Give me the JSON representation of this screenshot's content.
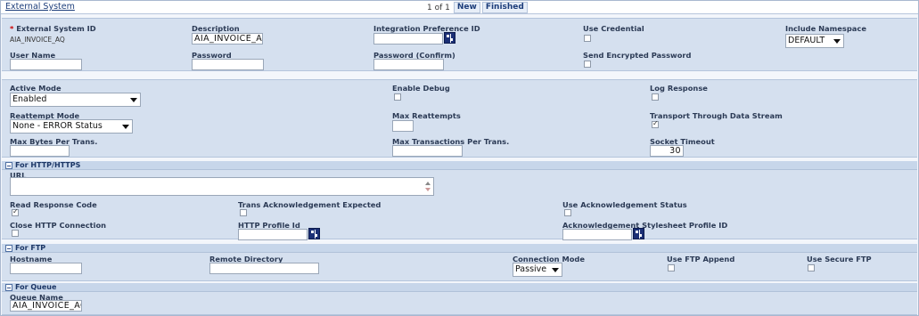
{
  "header": {
    "title": "External System",
    "pager": "1 of 1",
    "new_btn": "New",
    "finished_btn": "Finished"
  },
  "general": {
    "external_system_id_label": "External System ID",
    "external_system_id_value": "AIA_INVOICE_AQ",
    "description_label": "Description",
    "description_value": "AIA_INVOICE_AQ",
    "integration_pref_label": "Integration Preference ID",
    "integration_pref_value": "",
    "use_credential_label": "Use Credential",
    "include_namespace_label": "Include Namespace",
    "include_namespace_value": "DEFAULT",
    "user_name_label": "User Name",
    "password_label": "Password",
    "password_confirm_label": "Password (Confirm)",
    "send_encrypted_label": "Send Encrypted Password"
  },
  "mode": {
    "active_mode_label": "Active Mode",
    "active_mode_value": "Enabled",
    "enable_debug_label": "Enable Debug",
    "log_response_label": "Log Response",
    "reattempt_mode_label": "Reattempt Mode",
    "reattempt_mode_value": "None - ERROR Status",
    "max_reattempts_label": "Max Reattempts",
    "transport_label": "Transport Through Data Stream",
    "transport_checked": true,
    "max_bytes_label": "Max Bytes Per Trans.",
    "max_trans_label": "Max Transactions Per Trans.",
    "socket_timeout_label": "Socket Timeout",
    "socket_timeout_value": "30"
  },
  "http": {
    "section_label": "For HTTP/HTTPS",
    "url_label": "URL",
    "read_response_label": "Read Response Code",
    "read_response_checked": true,
    "trans_ack_label": "Trans Acknowledgement Expected",
    "use_ack_label": "Use Acknowledgement Status",
    "close_http_label": "Close HTTP Connection",
    "http_profile_label": "HTTP Profile Id",
    "ack_stylesheet_label": "Acknowledgement Stylesheet Profile ID"
  },
  "ftp": {
    "section_label": "For FTP",
    "hostname_label": "Hostname",
    "remote_dir_label": "Remote Directory",
    "conn_mode_label": "Connection Mode",
    "conn_mode_value": "Passive",
    "ftp_append_label": "Use FTP Append",
    "secure_ftp_label": "Use Secure FTP"
  },
  "queue": {
    "section_label": "For Queue",
    "queue_name_label": "Queue Name",
    "queue_name_value": "AIA_INVOICE_AQ"
  }
}
